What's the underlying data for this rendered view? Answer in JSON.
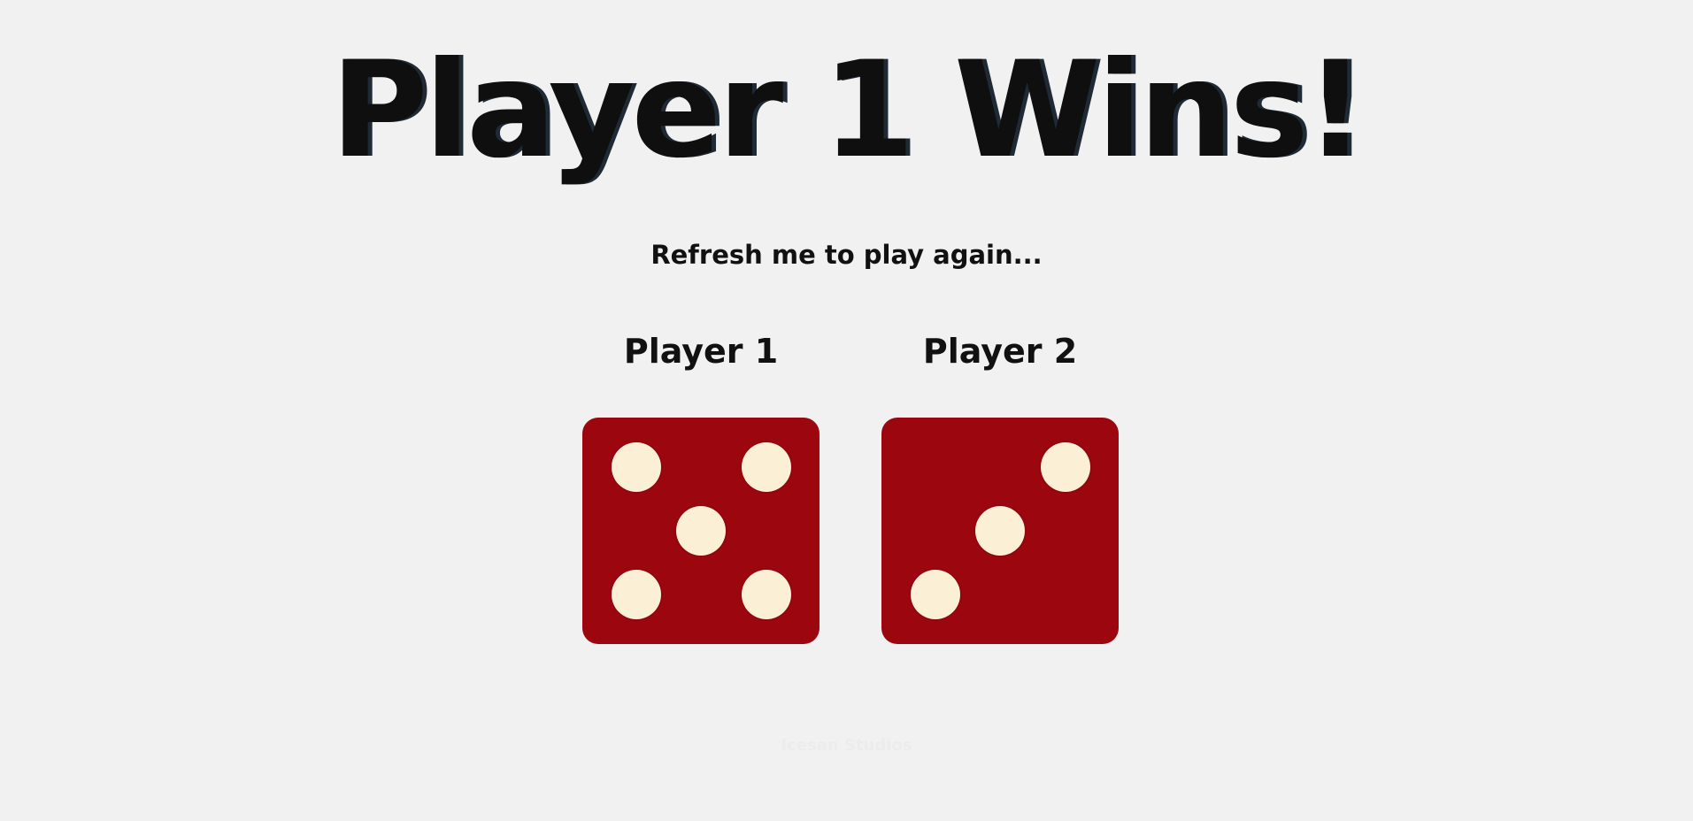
{
  "title": "Player 1 Wins!",
  "subtitle": "Refresh me to play again...",
  "players": [
    {
      "label": "Player 1",
      "die_value": 5
    },
    {
      "label": "Player 2",
      "die_value": 3
    }
  ],
  "footer": "Icesan Studios",
  "colors": {
    "background": "#f1f1f1",
    "die_face": "#9b060f",
    "pip": "#fbefd6",
    "text": "#0f0f0f"
  }
}
